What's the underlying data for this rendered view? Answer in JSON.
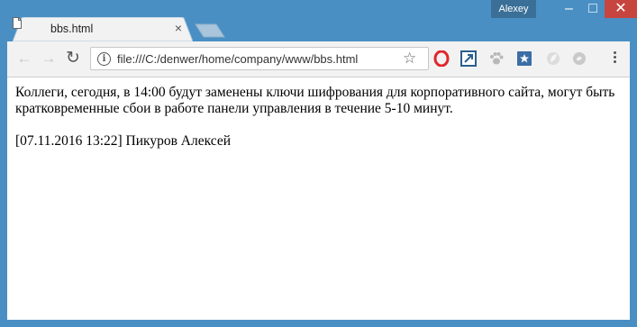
{
  "window": {
    "user": "Alexey"
  },
  "tab": {
    "title": "bbs.html",
    "close_glyph": "×"
  },
  "toolbar": {
    "back_glyph": "←",
    "forward_glyph": "→",
    "reload_glyph": "↻",
    "info_glyph": "i",
    "url": "file:///C:/denwer/home/company/www/bbs.html",
    "star_glyph": "☆"
  },
  "window_controls": {
    "minimize_glyph": "–",
    "maximize_glyph": "□",
    "close_glyph": "✕"
  },
  "page": {
    "message": "Коллеги, сегодня, в 14:00 будут заменены ключи шифрования для корпоративного сайта, могут быть кратковременные сбои в работе панели управления в течение 5-10 минут.",
    "signature": "[07.11.2016 13:22] Пикуров Алексей"
  },
  "colors": {
    "frame": "#4a8fc3",
    "close_button": "#c7453f",
    "opera": "#e0262b"
  }
}
